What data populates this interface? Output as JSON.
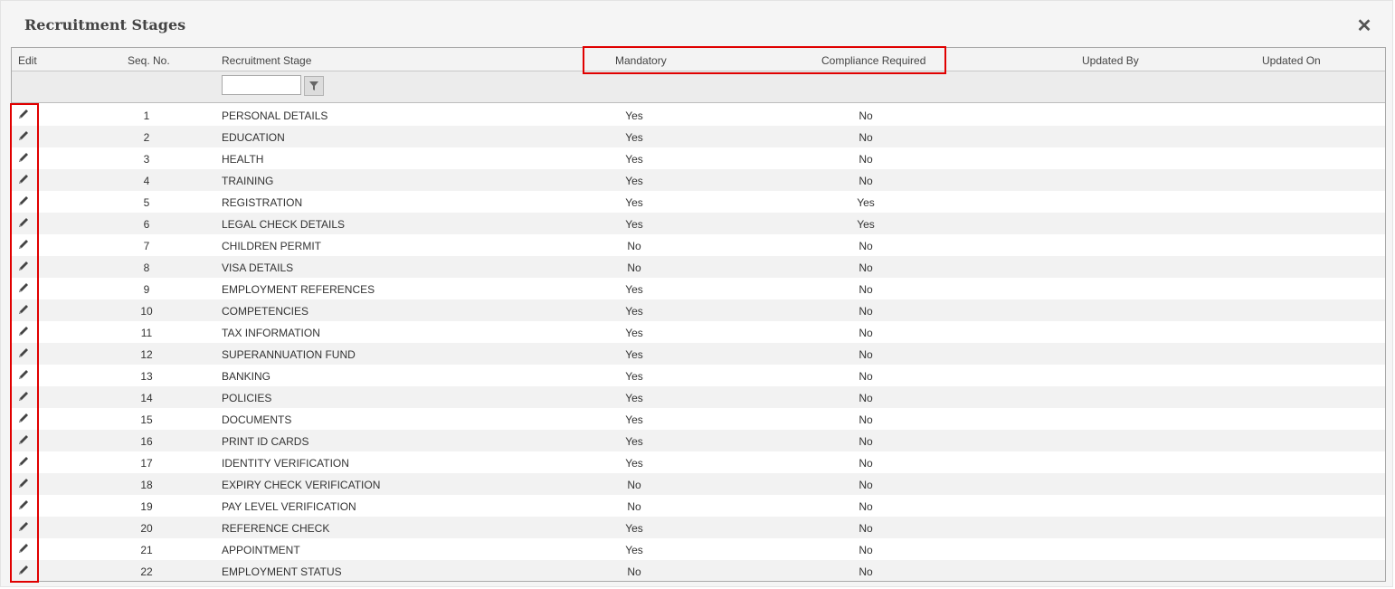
{
  "dialog": {
    "title": "Recruitment Stages",
    "close_icon": "close-icon"
  },
  "columns": {
    "edit": "Edit",
    "seq": "Seq. No.",
    "stage": "Recruitment Stage",
    "mandatory": "Mandatory",
    "compliance": "Compliance Required",
    "updated_by": "Updated By",
    "updated_on": "Updated On"
  },
  "filter": {
    "value": "",
    "icon": "filter-icon"
  },
  "rows": [
    {
      "seq": "1",
      "stage": "PERSONAL DETAILS",
      "mandatory": "Yes",
      "compliance": "No",
      "updated_by": "",
      "updated_on": ""
    },
    {
      "seq": "2",
      "stage": "EDUCATION",
      "mandatory": "Yes",
      "compliance": "No",
      "updated_by": "",
      "updated_on": ""
    },
    {
      "seq": "3",
      "stage": "HEALTH",
      "mandatory": "Yes",
      "compliance": "No",
      "updated_by": "",
      "updated_on": ""
    },
    {
      "seq": "4",
      "stage": "TRAINING",
      "mandatory": "Yes",
      "compliance": "No",
      "updated_by": "",
      "updated_on": ""
    },
    {
      "seq": "5",
      "stage": "REGISTRATION",
      "mandatory": "Yes",
      "compliance": "Yes",
      "updated_by": "",
      "updated_on": ""
    },
    {
      "seq": "6",
      "stage": "LEGAL CHECK DETAILS",
      "mandatory": "Yes",
      "compliance": "Yes",
      "updated_by": "",
      "updated_on": ""
    },
    {
      "seq": "7",
      "stage": "CHILDREN PERMIT",
      "mandatory": "No",
      "compliance": "No",
      "updated_by": "",
      "updated_on": ""
    },
    {
      "seq": "8",
      "stage": "VISA DETAILS",
      "mandatory": "No",
      "compliance": "No",
      "updated_by": "",
      "updated_on": ""
    },
    {
      "seq": "9",
      "stage": "EMPLOYMENT REFERENCES",
      "mandatory": "Yes",
      "compliance": "No",
      "updated_by": "",
      "updated_on": ""
    },
    {
      "seq": "10",
      "stage": "COMPETENCIES",
      "mandatory": "Yes",
      "compliance": "No",
      "updated_by": "",
      "updated_on": ""
    },
    {
      "seq": "11",
      "stage": "TAX INFORMATION",
      "mandatory": "Yes",
      "compliance": "No",
      "updated_by": "",
      "updated_on": ""
    },
    {
      "seq": "12",
      "stage": "SUPERANNUATION FUND",
      "mandatory": "Yes",
      "compliance": "No",
      "updated_by": "",
      "updated_on": ""
    },
    {
      "seq": "13",
      "stage": "BANKING",
      "mandatory": "Yes",
      "compliance": "No",
      "updated_by": "",
      "updated_on": ""
    },
    {
      "seq": "14",
      "stage": "POLICIES",
      "mandatory": "Yes",
      "compliance": "No",
      "updated_by": "",
      "updated_on": ""
    },
    {
      "seq": "15",
      "stage": "DOCUMENTS",
      "mandatory": "Yes",
      "compliance": "No",
      "updated_by": "",
      "updated_on": ""
    },
    {
      "seq": "16",
      "stage": "PRINT ID CARDS",
      "mandatory": "Yes",
      "compliance": "No",
      "updated_by": "",
      "updated_on": ""
    },
    {
      "seq": "17",
      "stage": "IDENTITY VERIFICATION",
      "mandatory": "Yes",
      "compliance": "No",
      "updated_by": "",
      "updated_on": ""
    },
    {
      "seq": "18",
      "stage": "EXPIRY CHECK VERIFICATION",
      "mandatory": "No",
      "compliance": "No",
      "updated_by": "",
      "updated_on": ""
    },
    {
      "seq": "19",
      "stage": "PAY LEVEL VERIFICATION",
      "mandatory": "No",
      "compliance": "No",
      "updated_by": "",
      "updated_on": ""
    },
    {
      "seq": "20",
      "stage": "REFERENCE CHECK",
      "mandatory": "Yes",
      "compliance": "No",
      "updated_by": "",
      "updated_on": ""
    },
    {
      "seq": "21",
      "stage": "APPOINTMENT",
      "mandatory": "Yes",
      "compliance": "No",
      "updated_by": "",
      "updated_on": ""
    },
    {
      "seq": "22",
      "stage": "EMPLOYMENT STATUS",
      "mandatory": "No",
      "compliance": "No",
      "updated_by": "",
      "updated_on": ""
    }
  ],
  "row_icon": "pencil-icon",
  "highlight_color": "#e00000"
}
